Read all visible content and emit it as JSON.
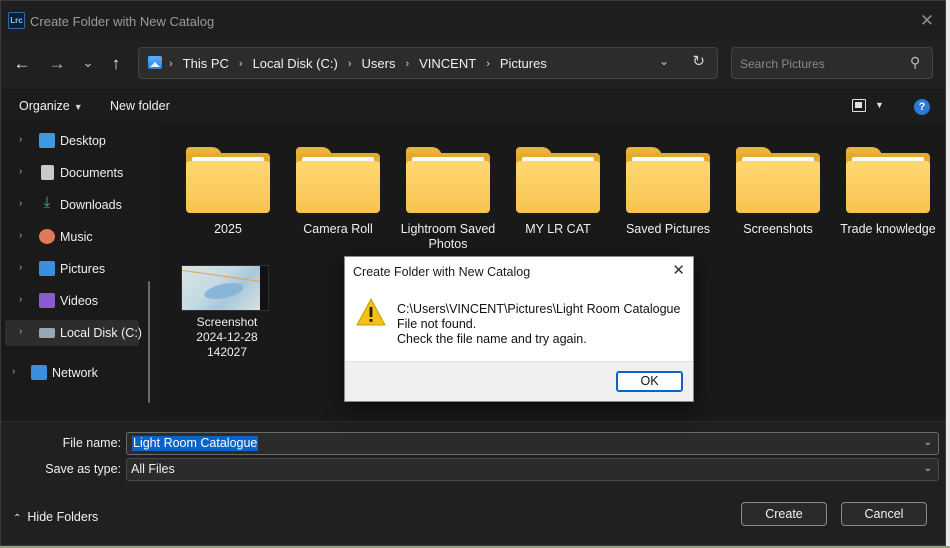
{
  "window": {
    "app_icon_text": "Lrc",
    "title": "Create Folder with New Catalog",
    "close_glyph": "✕"
  },
  "nav": {
    "back_glyph": "←",
    "forward_glyph": "→",
    "recent_glyph": "⌄",
    "up_glyph": "↑",
    "breadcrumbs": [
      "This PC",
      "Local Disk (C:)",
      "Users",
      "VINCENT",
      "Pictures"
    ],
    "refresh_glyph": "↻",
    "search_placeholder": "Search Pictures"
  },
  "commandbar": {
    "organize": "Organize",
    "new_folder": "New folder",
    "help": "?"
  },
  "sidebar": {
    "items": [
      {
        "label": "Desktop",
        "icon": "desktop-icon",
        "color": "#3a9be0"
      },
      {
        "label": "Documents",
        "icon": "documents-icon",
        "color": "#c9c9c9"
      },
      {
        "label": "Downloads",
        "icon": "downloads-icon",
        "color": "#3fbf7f"
      },
      {
        "label": "Music",
        "icon": "music-icon",
        "color": "#e0785a"
      },
      {
        "label": "Pictures",
        "icon": "pictures-icon",
        "color": "#3a8fe0"
      },
      {
        "label": "Videos",
        "icon": "videos-icon",
        "color": "#8a5ad0"
      },
      {
        "label": "Local Disk (C:)",
        "icon": "drive-icon",
        "color": "#9aa7b3"
      },
      {
        "label": "Network",
        "icon": "network-icon",
        "color": "#3a8fe0"
      }
    ]
  },
  "content": {
    "folders": [
      "2025",
      "Camera Roll",
      "Lightroom Saved Photos",
      "MY LR CAT",
      "Saved Pictures",
      "Screenshots",
      "Trade knowledge"
    ],
    "file": {
      "name_line1": "Screenshot",
      "name_line2": "2024-12-28",
      "name_line3": "142027"
    }
  },
  "bottom": {
    "file_name_label": "File name:",
    "file_name_value": "Light Room Catalogue",
    "save_type_label": "Save as type:",
    "save_type_value": "All Files",
    "hide_folders": "Hide Folders",
    "create_button": "Create",
    "cancel_button": "Cancel"
  },
  "modal": {
    "title": "Create Folder with New Catalog",
    "line1": "C:\\Users\\VINCENT\\Pictures\\Light Room Catalogue",
    "line2": "File not found.",
    "line3": "Check the file name and try again.",
    "ok_button": "OK",
    "close_glyph": "✕"
  }
}
